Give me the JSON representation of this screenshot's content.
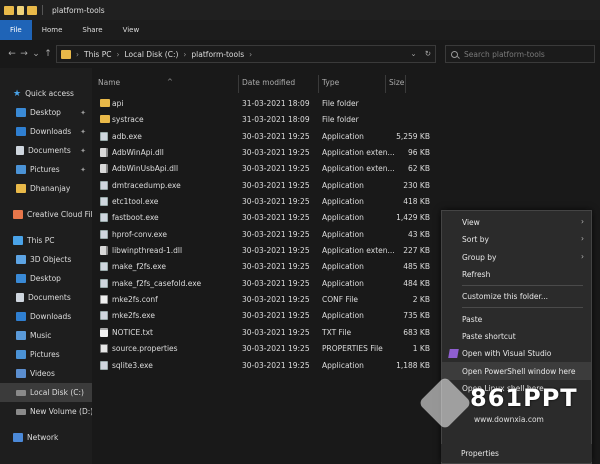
{
  "window": {
    "title": "platform-tools"
  },
  "ribbon": {
    "tabs": [
      "File",
      "Home",
      "Share",
      "View"
    ]
  },
  "address": {
    "segments": [
      "This PC",
      "Local Disk (C:)",
      "platform-tools"
    ],
    "search_placeholder": "Search platform-tools"
  },
  "sidebar": {
    "items": [
      {
        "label": "Quick access",
        "icon": "star-icon",
        "pinned": false
      },
      {
        "label": "Desktop",
        "icon": "desktop-icon",
        "pinned": true
      },
      {
        "label": "Downloads",
        "icon": "downloads-icon",
        "pinned": true
      },
      {
        "label": "Documents",
        "icon": "documents-icon",
        "pinned": true
      },
      {
        "label": "Pictures",
        "icon": "pictures-icon",
        "pinned": true
      },
      {
        "label": "Dhananjay",
        "icon": "folder-icon",
        "pinned": false
      },
      {
        "label": "Creative Cloud Files",
        "icon": "creative-cloud-icon",
        "pinned": false
      },
      {
        "label": "This PC",
        "icon": "this-pc-icon",
        "pinned": false
      },
      {
        "label": "3D Objects",
        "icon": "3d-objects-icon",
        "pinned": false
      },
      {
        "label": "Desktop",
        "icon": "desktop-icon",
        "pinned": false
      },
      {
        "label": "Documents",
        "icon": "documents-icon",
        "pinned": false
      },
      {
        "label": "Downloads",
        "icon": "downloads-icon",
        "pinned": false
      },
      {
        "label": "Music",
        "icon": "music-icon",
        "pinned": false
      },
      {
        "label": "Pictures",
        "icon": "pictures-icon",
        "pinned": false
      },
      {
        "label": "Videos",
        "icon": "videos-icon",
        "pinned": false
      },
      {
        "label": "Local Disk (C:)",
        "icon": "drive-icon",
        "pinned": false,
        "selected": true
      },
      {
        "label": "New Volume (D:)",
        "icon": "drive-icon",
        "pinned": false
      },
      {
        "label": "Network",
        "icon": "network-icon",
        "pinned": false
      }
    ]
  },
  "columns": {
    "name": "Name",
    "date": "Date modified",
    "type": "Type",
    "size": "Size"
  },
  "files": [
    {
      "name": "api",
      "date": "31-03-2021 18:09",
      "type": "File folder",
      "size": "",
      "kind": "folder"
    },
    {
      "name": "systrace",
      "date": "31-03-2021 18:09",
      "type": "File folder",
      "size": "",
      "kind": "folder"
    },
    {
      "name": "adb.exe",
      "date": "30-03-2021 19:25",
      "type": "Application",
      "size": "5,259 KB",
      "kind": "app"
    },
    {
      "name": "AdbWinApi.dll",
      "date": "30-03-2021 19:25",
      "type": "Application exten...",
      "size": "96 KB",
      "kind": "dll"
    },
    {
      "name": "AdbWinUsbApi.dll",
      "date": "30-03-2021 19:25",
      "type": "Application exten...",
      "size": "62 KB",
      "kind": "dll"
    },
    {
      "name": "dmtracedump.exe",
      "date": "30-03-2021 19:25",
      "type": "Application",
      "size": "230 KB",
      "kind": "app"
    },
    {
      "name": "etc1tool.exe",
      "date": "30-03-2021 19:25",
      "type": "Application",
      "size": "418 KB",
      "kind": "app"
    },
    {
      "name": "fastboot.exe",
      "date": "30-03-2021 19:25",
      "type": "Application",
      "size": "1,429 KB",
      "kind": "app"
    },
    {
      "name": "hprof-conv.exe",
      "date": "30-03-2021 19:25",
      "type": "Application",
      "size": "43 KB",
      "kind": "app"
    },
    {
      "name": "libwinpthread-1.dll",
      "date": "30-03-2021 19:25",
      "type": "Application exten...",
      "size": "227 KB",
      "kind": "dll"
    },
    {
      "name": "make_f2fs.exe",
      "date": "30-03-2021 19:25",
      "type": "Application",
      "size": "485 KB",
      "kind": "app"
    },
    {
      "name": "make_f2fs_casefold.exe",
      "date": "30-03-2021 19:25",
      "type": "Application",
      "size": "484 KB",
      "kind": "app"
    },
    {
      "name": "mke2fs.conf",
      "date": "30-03-2021 19:25",
      "type": "CONF File",
      "size": "2 KB",
      "kind": "conf"
    },
    {
      "name": "mke2fs.exe",
      "date": "30-03-2021 19:25",
      "type": "Application",
      "size": "735 KB",
      "kind": "app"
    },
    {
      "name": "NOTICE.txt",
      "date": "30-03-2021 19:25",
      "type": "TXT File",
      "size": "683 KB",
      "kind": "txt"
    },
    {
      "name": "source.properties",
      "date": "30-03-2021 19:25",
      "type": "PROPERTIES File",
      "size": "1 KB",
      "kind": "prop"
    },
    {
      "name": "sqlite3.exe",
      "date": "30-03-2021 19:25",
      "type": "Application",
      "size": "1,188 KB",
      "kind": "app"
    }
  ],
  "context_menu": {
    "items": [
      {
        "label": "View",
        "submenu": true
      },
      {
        "label": "Sort by",
        "submenu": true
      },
      {
        "label": "Group by",
        "submenu": true
      },
      {
        "label": "Refresh",
        "submenu": false
      },
      {
        "sep": true
      },
      {
        "label": "Customize this folder...",
        "submenu": false
      },
      {
        "sep": true
      },
      {
        "label": "Paste",
        "submenu": false
      },
      {
        "label": "Paste shortcut",
        "submenu": false
      },
      {
        "label": "Open with Visual Studio",
        "submenu": false,
        "icon": "visual-studio-icon"
      },
      {
        "label": "Open PowerShell window here",
        "submenu": false,
        "highlight": true
      },
      {
        "label": "Open Linux shell here",
        "submenu": false
      }
    ],
    "last_item": "Properties"
  },
  "watermark": {
    "brand": "861PPT",
    "url": "www.downxia.com"
  },
  "colors": {
    "file_tab": "#1f64b7",
    "folder": "#e9b949",
    "arrow": "#d62828"
  }
}
